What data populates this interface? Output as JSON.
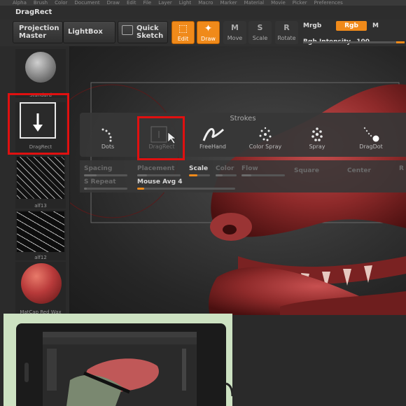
{
  "menubar": [
    "Alpha",
    "Brush",
    "Color",
    "Document",
    "Draw",
    "Edit",
    "File",
    "Layer",
    "Light",
    "Macro",
    "Marker",
    "Material",
    "Movie",
    "Picker",
    "Preferences"
  ],
  "title": "DragRect",
  "toolbar": {
    "projection_master": [
      "Projection",
      "Master"
    ],
    "lightbox": "LightBox",
    "quick_sketch": [
      "Quick",
      "Sketch"
    ],
    "edit": "Edit",
    "draw": "Draw",
    "move": "Move",
    "scale": "Scale",
    "rotate": "Rotate",
    "mrgb": "Mrgb",
    "rgb": "Rgb",
    "m": "M",
    "rgb_intensity_label": "Rgb Intensity",
    "rgb_intensity_value": "100",
    "move_letter": "M",
    "scale_letter": "S",
    "rotate_letter": "R"
  },
  "sidebar": {
    "tiles": [
      {
        "label": "Standard"
      },
      {
        "label": "DragRect"
      },
      {
        "label": "alf13"
      },
      {
        "label": "alf12"
      },
      {
        "label": "MatCap Red Wax"
      }
    ]
  },
  "strokes": {
    "title": "Strokes",
    "items": [
      "Dots",
      "DragRect",
      "FreeHand",
      "Color Spray",
      "Spray",
      "DragDot"
    ]
  },
  "settings": {
    "row1": [
      "Spacing",
      "Placement",
      "Scale",
      "Color",
      "Flow",
      "Square",
      "Center",
      "R"
    ],
    "row2": [
      "S Repeat",
      "Mouse Avg 4"
    ]
  },
  "colors": {
    "accent": "#f08a1a",
    "highlight_box": "#e01010",
    "sculpt": "#b83a3a"
  }
}
